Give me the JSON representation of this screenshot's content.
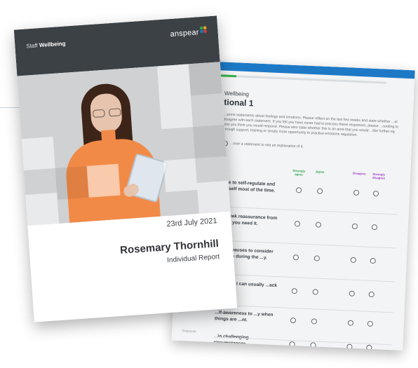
{
  "cover": {
    "brand_prefix": "Staff",
    "brand_label": "Wellbeing",
    "logo_text": "anspear",
    "logo_colors": [
      "#2fa84f",
      "#f5a623",
      "#1d79c6",
      "#e0403c"
    ],
    "date": "23rd July 2021",
    "name": "Rosemary Thornhill",
    "subtitle": "Individual Report"
  },
  "questionnaire": {
    "overline": "Wellbeing",
    "title": "tional 1",
    "intro": "...some statements about feelings and emotions. Please reflect on the last few weeks and state whether ...or disagree with each statement. If you felt you have never had to process these responses, please ...cording to how you think you would respond. Please also state whether this is an area that you would ...like further eg through support, training or simply more opportunity to practise emotions regulation.",
    "hint": "...over a statement to see an explanation of it.",
    "columns": {
      "strongly_agree": "Strongly agree",
      "agree": "Agree",
      "disagree": "Disagree",
      "strongly_disagree": "Strongly disagree"
    },
    "accent_green": "#2fa84f",
    "accent_purple": "#a13ec7",
    "header_color": "#1d79c6",
    "questions": [
      "...ble to self-regulate and ...urself most of the time.",
      "...y seek reassurance from ...hen you need it.",
      "...ular pauses to consider ...needs during the ...y.",
      "...wrong, I can usually ...ack on track.",
      "...lf-awareness to ...y when things are ...nt.",
      "...in challenging circumstances."
    ],
    "footer": "Staqspear"
  }
}
